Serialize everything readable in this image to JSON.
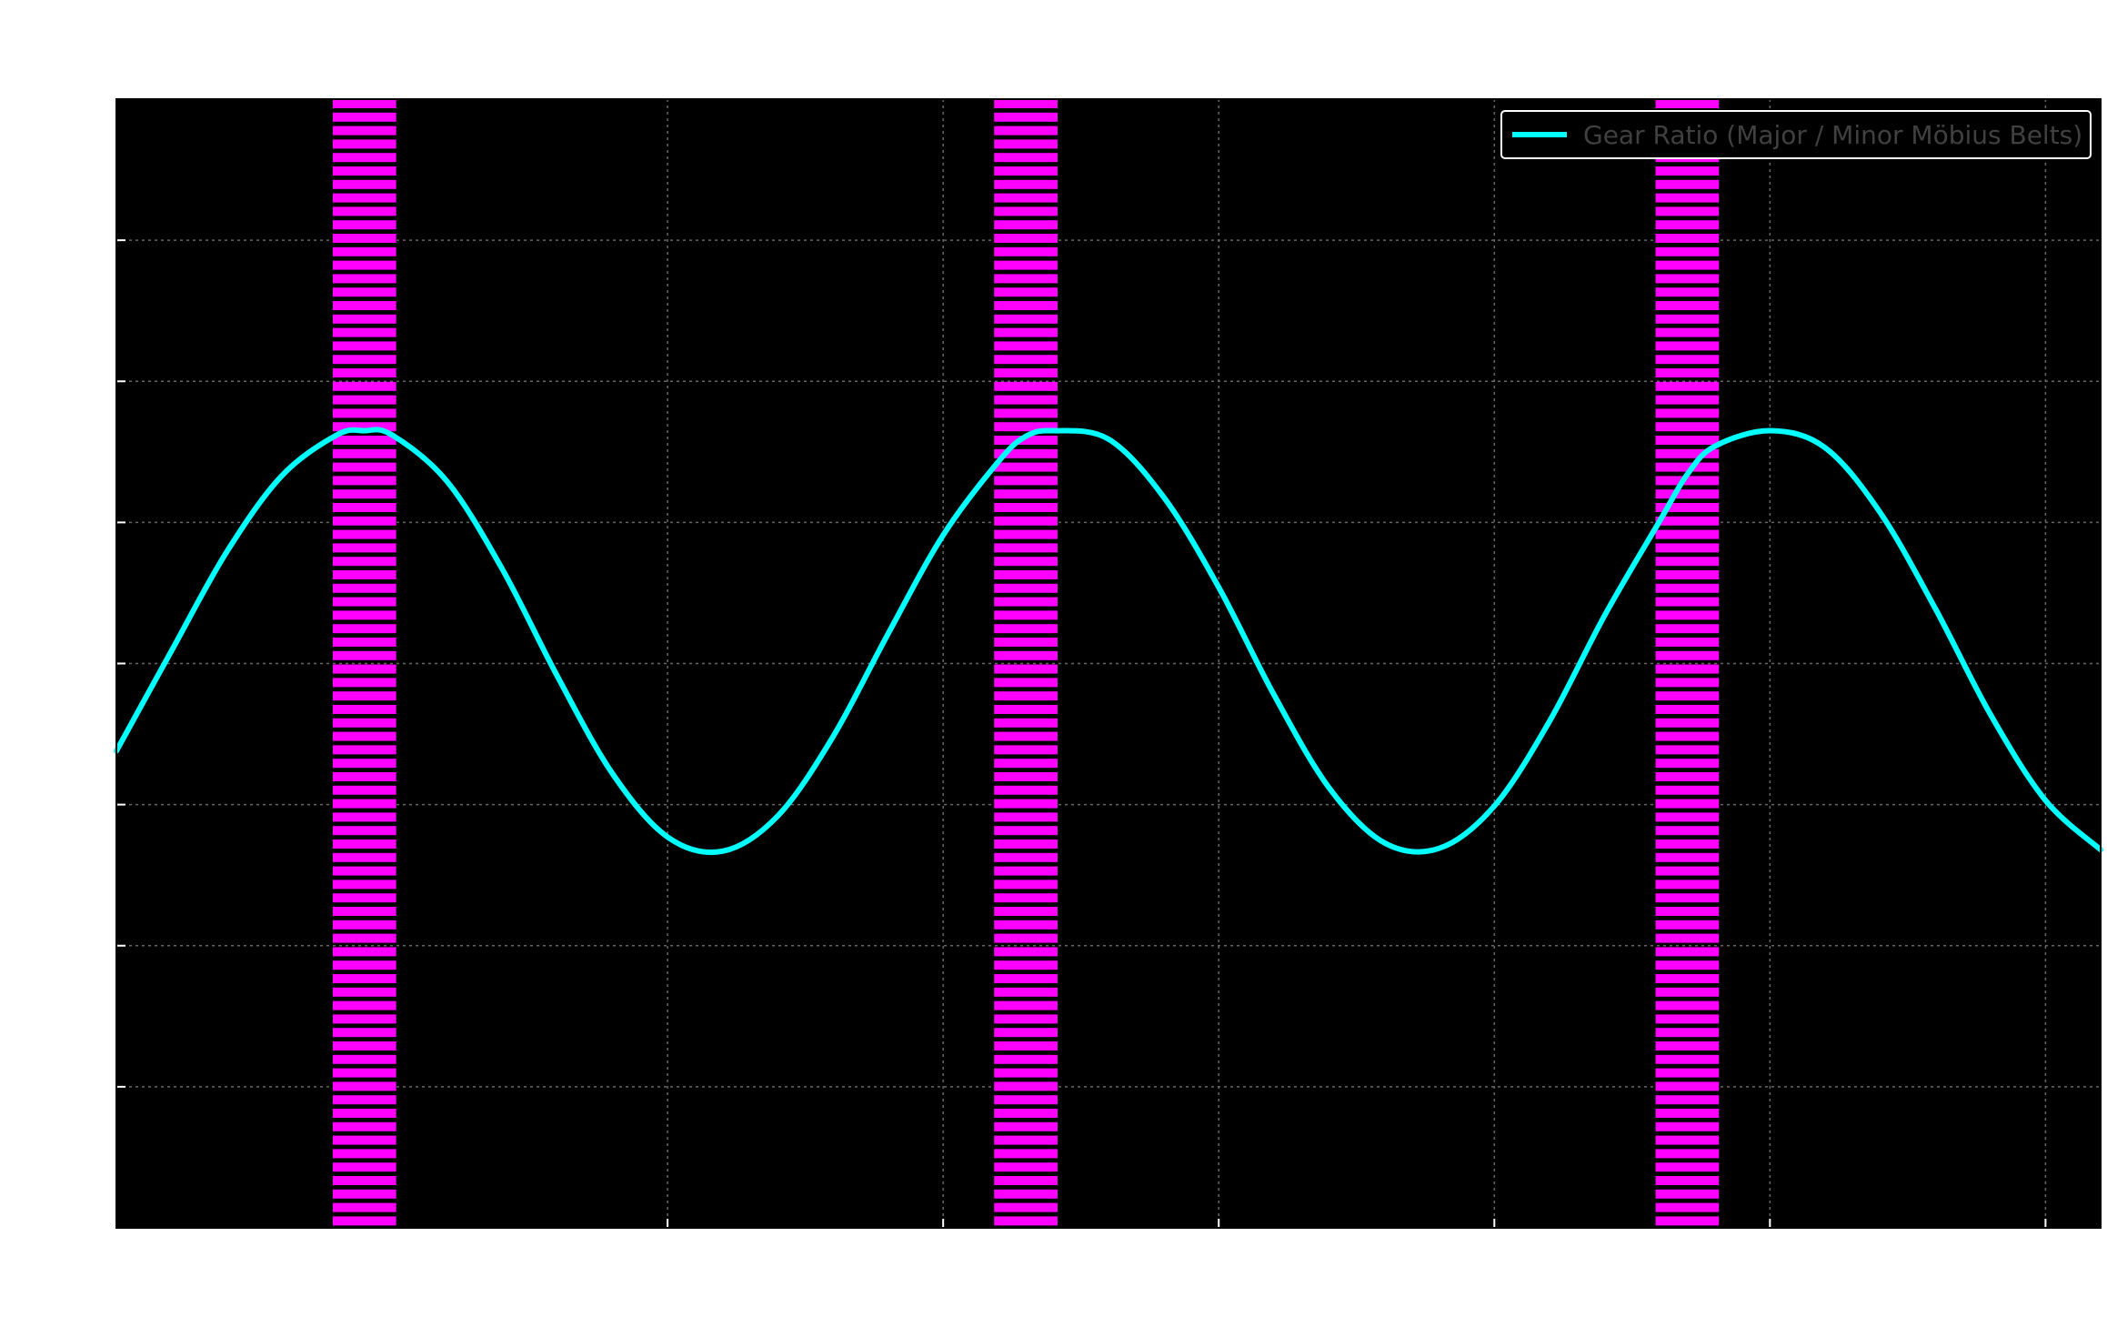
{
  "chart_data": {
    "type": "line",
    "title": "",
    "xlabel": "",
    "ylabel": "",
    "x_range": [
      0,
      7.2
    ],
    "y_range": [
      0,
      8
    ],
    "grid": true,
    "legend_placement": "top-right",
    "background": "#000000",
    "series": [
      {
        "name": "Gear Ratio (Major / Minor Möbius Belts)",
        "color": "#00ffff",
        "x": [
          0,
          0.2,
          0.4,
          0.6,
          0.8,
          0.9,
          1.0,
          1.2,
          1.4,
          1.6,
          1.8,
          2.0,
          2.2,
          2.4,
          2.6,
          2.8,
          3.0,
          3.2,
          3.3,
          3.4,
          3.6,
          3.8,
          4.0,
          4.2,
          4.4,
          4.6,
          4.8,
          5.0,
          5.2,
          5.4,
          5.6,
          5.7,
          5.8,
          6.0,
          6.2,
          6.4,
          6.6,
          6.8,
          7.0,
          7.2
        ],
        "y": [
          3.38,
          4.09,
          4.79,
          5.33,
          5.62,
          5.65,
          5.62,
          5.29,
          4.67,
          3.91,
          3.22,
          2.77,
          2.67,
          2.92,
          3.48,
          4.21,
          4.91,
          5.43,
          5.61,
          5.65,
          5.59,
          5.18,
          4.54,
          3.78,
          3.12,
          2.73,
          2.69,
          2.99,
          3.59,
          4.34,
          5.01,
          5.34,
          5.54,
          5.65,
          5.53,
          5.07,
          4.39,
          3.64,
          3.03,
          2.68
        ]
      }
    ],
    "highlight_bands": [
      {
        "center": 0.9,
        "width": 0.23,
        "color": "#ff00ff"
      },
      {
        "center": 3.3,
        "width": 0.23,
        "color": "#ff00ff"
      },
      {
        "center": 5.7,
        "width": 0.23,
        "color": "#ff00ff"
      }
    ],
    "x_ticks": [
      2,
      3,
      4,
      5,
      6,
      7
    ],
    "y_ticks": [
      1,
      2,
      3,
      4,
      5,
      6,
      7
    ]
  }
}
